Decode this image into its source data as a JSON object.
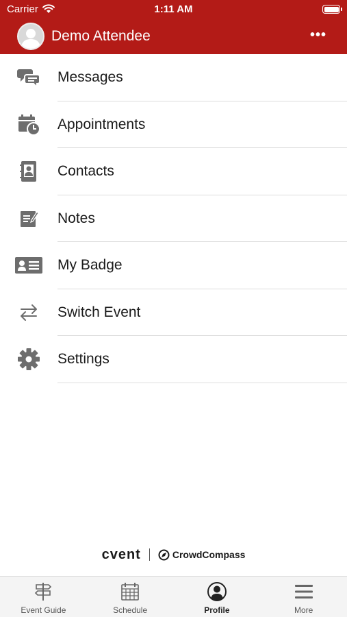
{
  "status_bar": {
    "carrier": "Carrier",
    "time": "1:11 AM"
  },
  "header": {
    "user_name": "Demo Attendee",
    "more_label": "•••"
  },
  "menu": {
    "items": [
      {
        "label": "Messages",
        "icon": "chat-icon"
      },
      {
        "label": "Appointments",
        "icon": "calendar-clock-icon"
      },
      {
        "label": "Contacts",
        "icon": "contact-book-icon"
      },
      {
        "label": "Notes",
        "icon": "note-icon"
      },
      {
        "label": "My Badge",
        "icon": "badge-icon"
      },
      {
        "label": "Switch Event",
        "icon": "switch-arrows-icon"
      },
      {
        "label": "Settings",
        "icon": "gear-icon"
      }
    ]
  },
  "branding": {
    "cvent": "cvent",
    "crowdcompass": "CrowdCompass"
  },
  "tabbar": {
    "tabs": [
      {
        "label": "Event Guide",
        "icon": "signpost-icon",
        "active": false
      },
      {
        "label": "Schedule",
        "icon": "calendar-icon",
        "active": false
      },
      {
        "label": "Profile",
        "icon": "profile-icon",
        "active": true
      },
      {
        "label": "More",
        "icon": "menu-icon",
        "active": false
      }
    ]
  },
  "colors": {
    "brand_red": "#b31b17",
    "icon_gray": "#6d6d6d"
  }
}
